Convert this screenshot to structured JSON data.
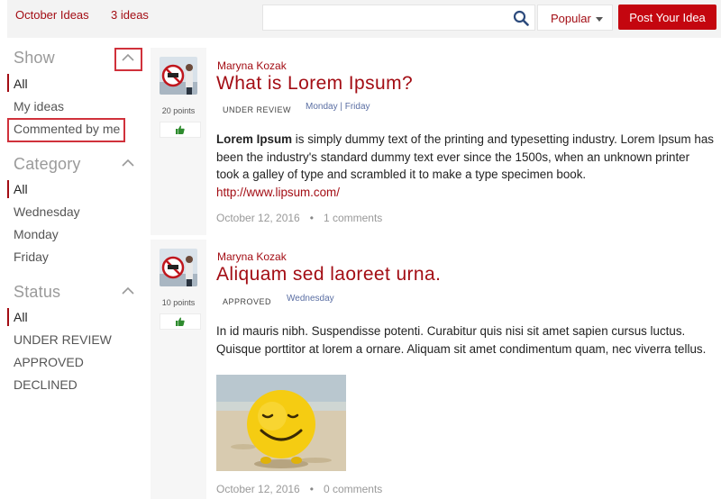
{
  "header": {
    "title": "October Ideas",
    "count": "3 ideas",
    "search": {
      "value": "",
      "placeholder": ""
    },
    "sort_label": "Popular",
    "post_button": "Post Your Idea"
  },
  "sidebar": {
    "show": {
      "heading": "Show",
      "items": [
        "All",
        "My ideas",
        "Commented by me"
      ]
    },
    "category": {
      "heading": "Category",
      "items": [
        "All",
        "Wednesday",
        "Monday",
        "Friday"
      ]
    },
    "status": {
      "heading": "Status",
      "items": [
        "All",
        "UNDER REVIEW",
        "APPROVED",
        "DECLINED"
      ]
    }
  },
  "ideas": [
    {
      "author": "Maryna Kozak",
      "title": "What is Lorem Ipsum?",
      "status": "UNDER REVIEW",
      "categories": "Monday | Friday",
      "points": "20 points",
      "body_bold": "Lorem Ipsum",
      "body": " is simply dummy text of the printing and typesetting industry. Lorem Ipsum has been the industry's standard dummy text ever since the 1500s, when an unknown printer took a galley of type and scrambled it to make a type specimen book.",
      "link": "http://www.lipsum.com/",
      "date": "October 12, 2016",
      "comments": "1 comments"
    },
    {
      "author": "Maryna Kozak",
      "title": "Aliquam sed laoreet urna.",
      "status": "APPROVED",
      "categories": "Wednesday",
      "points": "10 points",
      "body": "In id mauris nibh. Suspendisse potenti. Curabitur quis nisi sit amet sapien cursus luctus. Quisque porttitor at lorem a ornare. Aliquam sit amet condimentum quam, nec viverra tellus.",
      "date": "October 12, 2016",
      "comments": "0 comments"
    }
  ],
  "colors": {
    "accent": "#a30d14",
    "button": "#c4060f",
    "highlight_box": "#d0313b",
    "category_link": "#5a6ea3"
  },
  "icons": {
    "search": "search-icon",
    "sort_caret": "caret-down-icon",
    "collapse": "chevron-up-icon",
    "vote": "thumbs-up-icon"
  }
}
